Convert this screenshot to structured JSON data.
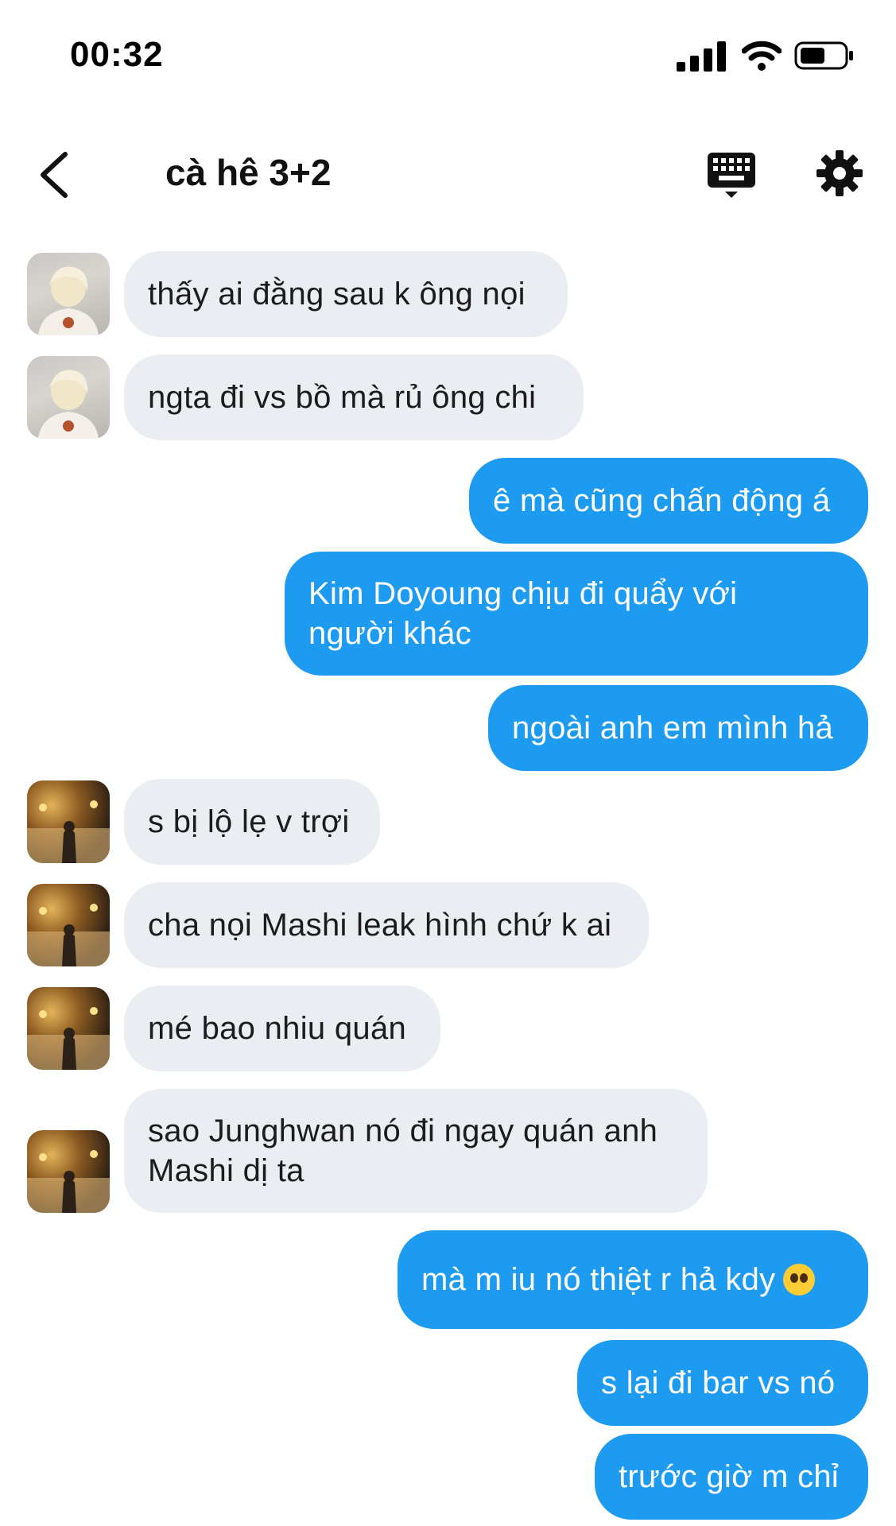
{
  "status_bar": {
    "time": "00:32"
  },
  "header": {
    "title": "cà hê 3+2"
  },
  "messages": [
    {
      "text": "thấy ai đằng sau k ông nọi"
    },
    {
      "text": "ngta đi vs bồ mà rủ ông chi"
    },
    {
      "text": "ê mà cũng chấn động á"
    },
    {
      "text": "Kim Doyoung chịu đi quẩy với người khác"
    },
    {
      "text": "ngoài anh em mình hả"
    },
    {
      "text": "s bị lộ lẹ v trợi"
    },
    {
      "text": "cha nọi Mashi leak hình chứ k ai"
    },
    {
      "text": "mé bao nhiu quán"
    },
    {
      "text": "sao Junghwan nó đi ngay quán anh Mashi dị ta"
    },
    {
      "text": "mà m iu nó thiệt r hả kdy"
    },
    {
      "text": "s lại đi bar vs nó"
    },
    {
      "text": "trước giờ m chỉ"
    }
  ],
  "colors": {
    "outgoing_bubble": "#1d9bf0",
    "incoming_bubble": "#eaedf1"
  },
  "icons": {
    "back": "chevron-left-icon",
    "keyboard": "keyboard-icon",
    "settings": "gear-icon",
    "emoji": "pleading-face-icon"
  }
}
